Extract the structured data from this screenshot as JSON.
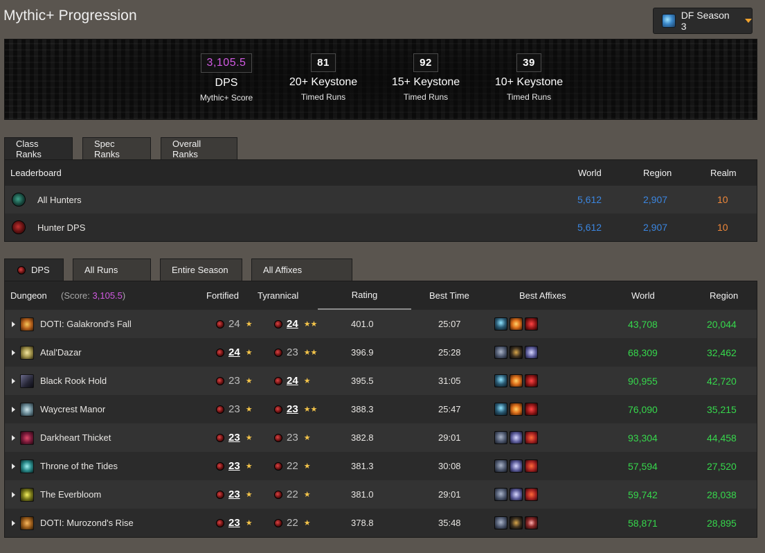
{
  "page": {
    "title": "Mythic+ Progression"
  },
  "season": {
    "label": "DF Season 3",
    "icon": "season-crystal-icon"
  },
  "banner": {
    "score": {
      "value": "3,105.5",
      "label": "DPS",
      "sub": "Mythic+ Score",
      "color": "#d35ae4"
    },
    "keystones": [
      {
        "value": "81",
        "label": "20+ Keystone",
        "sub": "Timed Runs"
      },
      {
        "value": "92",
        "label": "15+ Keystone",
        "sub": "Timed Runs"
      },
      {
        "value": "39",
        "label": "10+ Keystone",
        "sub": "Timed Runs"
      }
    ]
  },
  "rank_tabs": [
    "Class Ranks",
    "Spec Ranks",
    "Overall Ranks"
  ],
  "ranks": {
    "headers": {
      "name": "Leaderboard",
      "world": "World",
      "region": "Region",
      "realm": "Realm"
    },
    "rows": [
      {
        "name": "All Hunters",
        "world": "5,612",
        "region": "2,907",
        "realm": "10",
        "icon": "hunter-class-icon"
      },
      {
        "name": "Hunter DPS",
        "world": "5,612",
        "region": "2,907",
        "realm": "10",
        "icon": "dps-role-icon"
      }
    ]
  },
  "run_tabs": {
    "dps": "DPS",
    "runs": "All Runs",
    "season": "Entire Season",
    "affixes": "All Affixes"
  },
  "dungeons": {
    "headers": {
      "dungeon": "Dungeon",
      "score_prefix": "(Score: ",
      "score_value": "3,105.5",
      "score_suffix": ")",
      "fortified": "Fortified",
      "tyrannical": "Tyrannical",
      "rating": "Rating",
      "best_time": "Best Time",
      "best_affixes": "Best Affixes",
      "world": "World",
      "region": "Region"
    },
    "rows": [
      {
        "name": "DOTI: Galakrond's Fall",
        "fort": "24",
        "fort_stars": "★",
        "fort_best": false,
        "tyr": "24",
        "tyr_stars": "★★",
        "tyr_best": true,
        "rating": "401.0",
        "time": "25:07",
        "affixes": [
          "af-tyr",
          "af-incor",
          "af-burst"
        ],
        "world": "43,708",
        "region": "20,044",
        "icon_bg": "radial-gradient(circle at 50% 50%, #f7c65a 0, #b8621c 50%, #3a1c05 100%)"
      },
      {
        "name": "Atal'Dazar",
        "fort": "24",
        "fort_stars": "★",
        "fort_best": true,
        "tyr": "23",
        "tyr_stars": "★★",
        "tyr_best": false,
        "rating": "396.9",
        "time": "25:28",
        "affixes": [
          "af-fort",
          "af-storm",
          "af-spite"
        ],
        "world": "68,309",
        "region": "32,462",
        "icon_bg": "radial-gradient(circle at 50% 50%, #f4e6a0 0, #a0924a 50%, #2e2810 100%)"
      },
      {
        "name": "Black Rook Hold",
        "fort": "23",
        "fort_stars": "★",
        "fort_best": false,
        "tyr": "24",
        "tyr_stars": "★",
        "tyr_best": true,
        "rating": "395.5",
        "time": "31:05",
        "affixes": [
          "af-tyr",
          "af-incor",
          "af-burst"
        ],
        "world": "90,955",
        "region": "42,720",
        "icon_bg": "linear-gradient(135deg, #6a6a8a 0, #262636 60%, #0c0c14 100%)"
      },
      {
        "name": "Waycrest Manor",
        "fort": "23",
        "fort_stars": "★",
        "fort_best": false,
        "tyr": "23",
        "tyr_stars": "★★",
        "tyr_best": true,
        "rating": "388.3",
        "time": "25:47",
        "affixes": [
          "af-tyr",
          "af-incor",
          "af-burst"
        ],
        "world": "76,090",
        "region": "35,215",
        "icon_bg": "radial-gradient(circle at 50% 50%, #cfe6ec 0, #6a8a96 50%, #1e2a30 100%)"
      },
      {
        "name": "Darkheart Thicket",
        "fort": "23",
        "fort_stars": "★",
        "fort_best": true,
        "tyr": "23",
        "tyr_stars": "★",
        "tyr_best": false,
        "rating": "382.8",
        "time": "29:01",
        "affixes": [
          "af-fort",
          "af-spite",
          "af-sang"
        ],
        "world": "93,304",
        "region": "44,458",
        "icon_bg": "radial-gradient(circle at 50% 50%, #e04a6a 0, #7a1a3a 50%, #24060f 100%)"
      },
      {
        "name": "Throne of the Tides",
        "fort": "23",
        "fort_stars": "★",
        "fort_best": true,
        "tyr": "22",
        "tyr_stars": "★",
        "tyr_best": false,
        "rating": "381.3",
        "time": "30:08",
        "affixes": [
          "af-fort",
          "af-spite",
          "af-sang"
        ],
        "world": "57,594",
        "region": "27,520",
        "icon_bg": "radial-gradient(circle at 50% 50%, #9ff0f0 0, #2a8a8a 50%, #062424 100%)"
      },
      {
        "name": "The Everbloom",
        "fort": "23",
        "fort_stars": "★",
        "fort_best": true,
        "tyr": "22",
        "tyr_stars": "★",
        "tyr_best": false,
        "rating": "381.0",
        "time": "29:01",
        "affixes": [
          "af-fort",
          "af-spite",
          "af-sang"
        ],
        "world": "59,742",
        "region": "28,038",
        "icon_bg": "radial-gradient(circle at 50% 50%, #f4f060 0, #7a7a1a 50%, #202006 100%)"
      },
      {
        "name": "DOTI: Murozond's Rise",
        "fort": "23",
        "fort_stars": "★",
        "fort_best": true,
        "tyr": "22",
        "tyr_stars": "★",
        "tyr_best": false,
        "rating": "378.8",
        "time": "35:48",
        "affixes": [
          "af-fort",
          "af-storm",
          "af-bolster"
        ],
        "world": "58,871",
        "region": "28,895",
        "icon_bg": "radial-gradient(circle at 50% 50%, #f7b860 0, #a0601c 50%, #2e1a05 100%)"
      }
    ]
  }
}
